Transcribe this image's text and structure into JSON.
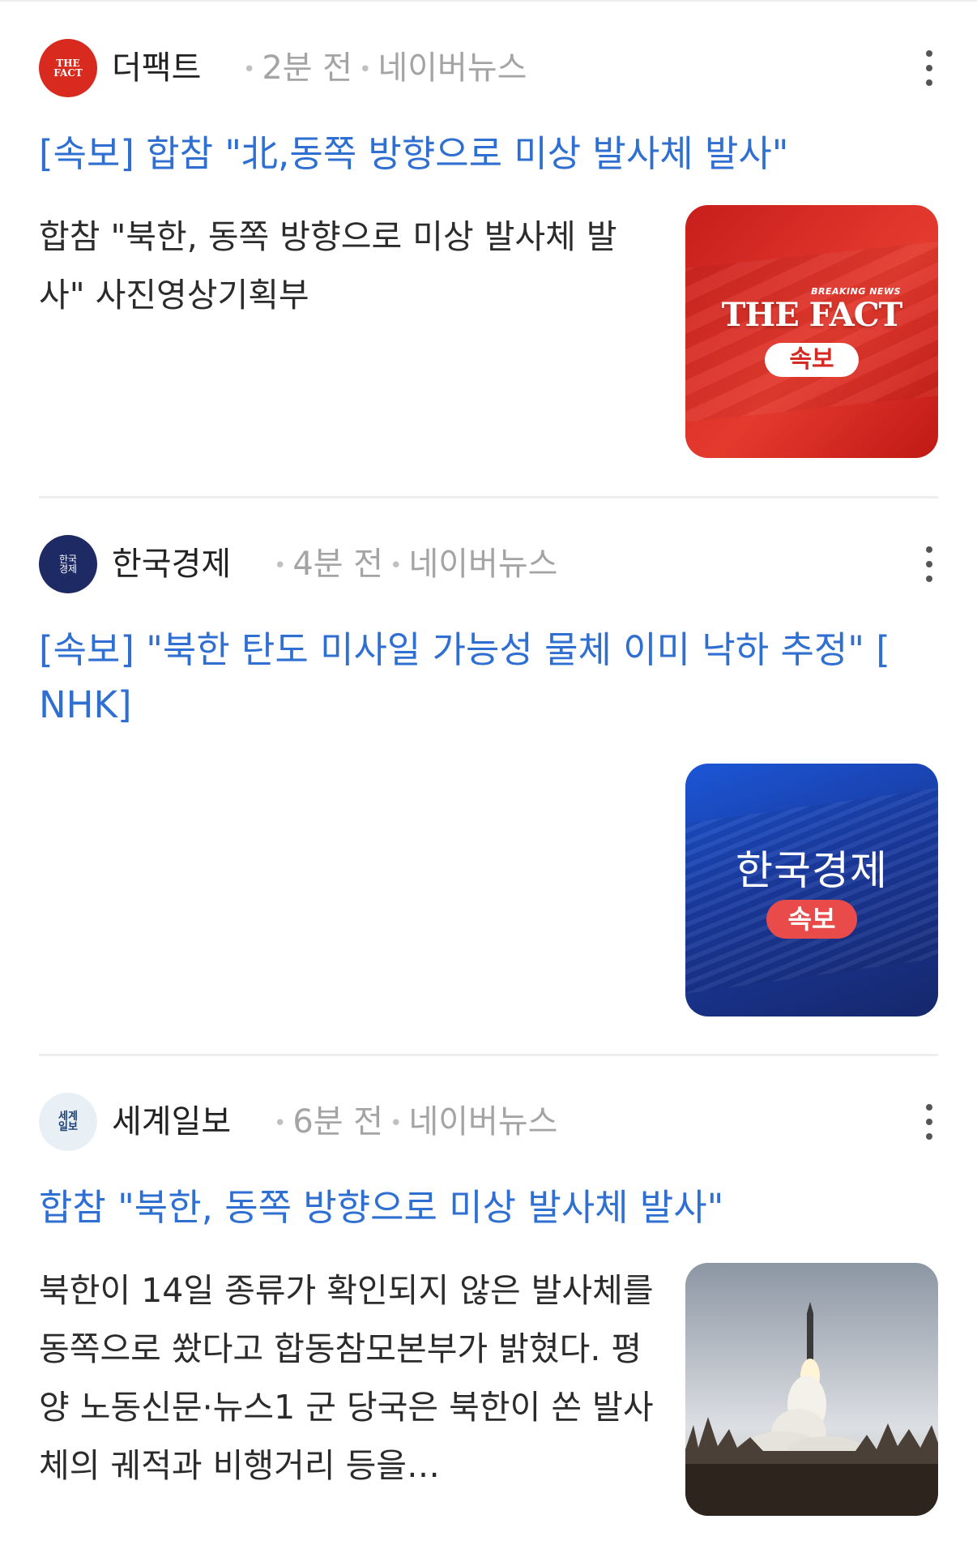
{
  "articles": [
    {
      "press": "더팩트",
      "time": "2분 전",
      "source": "네이버뉴스",
      "headline": "[속보] 합참 \"北,동쪽 방향으로 미상 발사체 발사\"",
      "summary": "합참 \"북한, 동쪽 방향으로 미상 발사체 발사\" 사진영상기획부",
      "logo": {
        "line1": "THE",
        "line2": "FACT"
      },
      "thumb": {
        "kicker": "BREAKING NEWS",
        "brand": "THE FACT",
        "badge": "속보"
      }
    },
    {
      "press": "한국경제",
      "time": "4분 전",
      "source": "네이버뉴스",
      "headline": "[속보] \"북한 탄도 미사일 가능성 물체 이미 낙하 추정\" [ NHK]",
      "logo": {
        "line1": "한국",
        "line2": "경제"
      },
      "thumb": {
        "brand": "한국경제",
        "badge": "속보"
      }
    },
    {
      "press": "세계일보",
      "time": "6분 전",
      "source": "네이버뉴스",
      "headline": "합참 \"북한, 동쪽 방향으로 미상 발사체 발사\"",
      "summary": "북한이 14일 종류가 확인되지 않은 발사체를 동쪽으로 쐈다고 합동참모본부가 밝혔다. 평양 노동신문·뉴스1 군 당국은 북한이 쏜 발사체의 궤적과 비행거리 등을…",
      "logo": {
        "line1": "세계",
        "line2": "일보"
      },
      "thumb": {
        "image": "missile-launch-photo"
      }
    }
  ],
  "icons": {
    "more": "more-vertical-icon"
  },
  "colors": {
    "headline": "#2e6fd1",
    "meta": "#a4a4a4",
    "fact_red": "#d92a1f",
    "hk_navy": "#1e2a63"
  }
}
